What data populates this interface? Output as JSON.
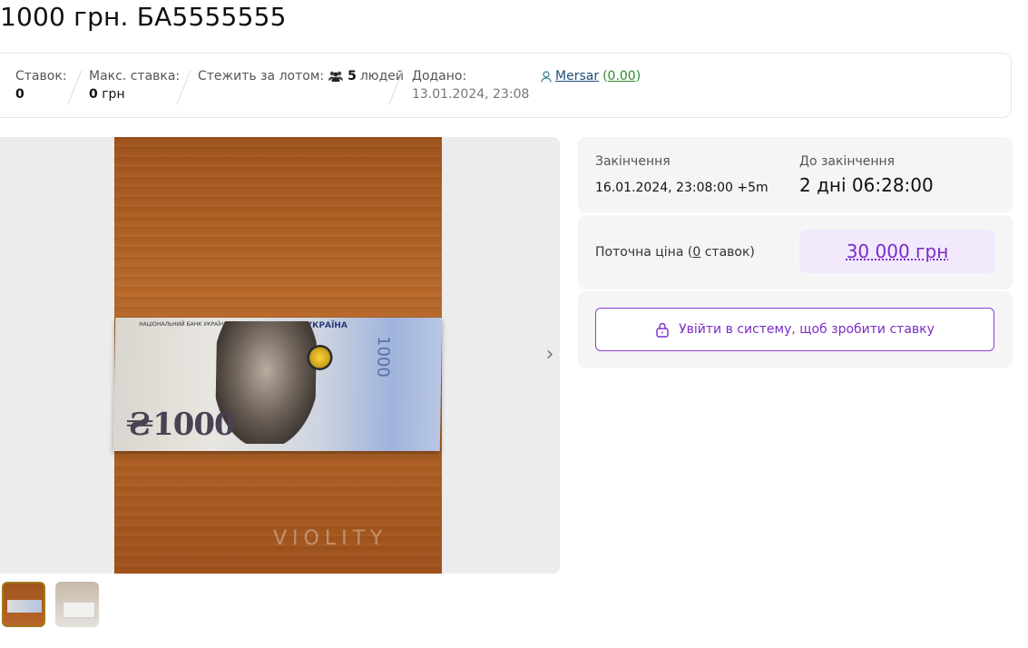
{
  "lot": {
    "title": "1000 грн. БА5555555"
  },
  "stats": {
    "bids_label": "Ставок:",
    "bids_value": "0",
    "max_bid_label": "Макс. ставка:",
    "max_bid_value": "0",
    "max_bid_currency": " грн",
    "watch_label": "Стежить за лотом:",
    "watch_count": "5",
    "watch_suffix": "людей",
    "added_label": "Додано:",
    "added_value": "13.01.2024, 23:08",
    "seller_name": "Mersar",
    "seller_rating": "0.00"
  },
  "gallery": {
    "watermark": "VIOLITY",
    "next_icon": "chevron-right-icon"
  },
  "auction": {
    "end_label": "Закінчення",
    "end_value": "16.01.2024, 23:08:00 +5m",
    "remaining_label": "До закінчення",
    "remaining_value": "2 дні 06:28:00",
    "current_price_label_prefix": "Поточна ціна (",
    "current_price_bids": "0",
    "current_price_label_suffix": " ставок)",
    "current_price": "30 000 грн",
    "login_button": "Увійти в систему, щоб зробити ставку"
  },
  "colors": {
    "accent": "#7b2cc8",
    "price_bg": "#f2e9fd",
    "panel_bg": "#f5f5f6",
    "rating": "#2e8b2e"
  }
}
